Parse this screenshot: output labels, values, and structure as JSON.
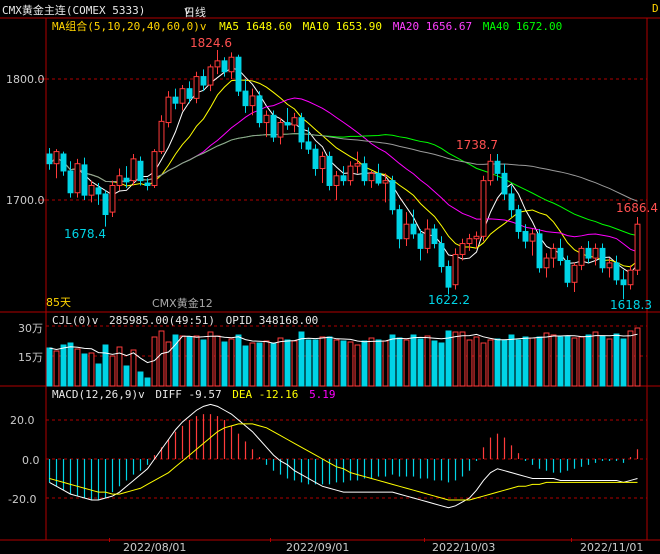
{
  "header": {
    "symbol": "CMX黄金主连(COMEX 5333)",
    "period": "日线",
    "period_arrow": "v",
    "right_mark": "D"
  },
  "main": {
    "ma_group": "MA组合(5,10,20,40,60,0)",
    "ma_arrow": "v",
    "ma5": "MA5 1648.60",
    "ma10": "MA10 1653.90",
    "ma20": "MA20 1656.67",
    "ma40": "MA40 1672.00",
    "annotations": {
      "high1": "1824.6",
      "high2": "1738.7",
      "last_high": "1686.4",
      "low1": "1678.4",
      "low2": "1622.2",
      "low3": "1618.3"
    },
    "days": "85天",
    "overlay_label": "CMX黄金12",
    "y_ticks": [
      "1800.0",
      "1700.0"
    ]
  },
  "volume": {
    "title": "CJL(0)",
    "arrow": "v",
    "value": "285985.00(49:51)",
    "opid": "OPID 348168.00",
    "y_ticks": [
      "30万",
      "15万"
    ]
  },
  "macd": {
    "title": "MACD(12,26,9)",
    "arrow": "v",
    "diff": "DIFF -9.57",
    "dea": "DEA -12.16",
    "macd_val": "5.19",
    "y_ticks": [
      "20.0",
      "0.0",
      "-20.0"
    ]
  },
  "x_axis": [
    "2022/08/01",
    "2022/09/01",
    "2022/10/03",
    "2022/11/01"
  ],
  "colors": {
    "up": "#ff3b3b",
    "down": "#00d4e6",
    "grid": "#b00000",
    "ma5": "#ffffff",
    "ma10": "#ffff00",
    "ma20": "#ff00ff",
    "ma40": "#00ff00",
    "ma60": "#9a9a9a"
  },
  "chart_data": {
    "type": "candlestick",
    "ylim": [
      1610,
      1860
    ],
    "candles": [
      {
        "o": 1738,
        "h": 1743,
        "l": 1725,
        "c": 1730
      },
      {
        "o": 1730,
        "h": 1742,
        "l": 1718,
        "c": 1740
      },
      {
        "o": 1738,
        "h": 1740,
        "l": 1720,
        "c": 1724
      },
      {
        "o": 1724,
        "h": 1732,
        "l": 1702,
        "c": 1706
      },
      {
        "o": 1706,
        "h": 1734,
        "l": 1702,
        "c": 1730
      },
      {
        "o": 1729,
        "h": 1735,
        "l": 1700,
        "c": 1704
      },
      {
        "o": 1704,
        "h": 1716,
        "l": 1698,
        "c": 1712
      },
      {
        "o": 1710,
        "h": 1714,
        "l": 1696,
        "c": 1705
      },
      {
        "o": 1705,
        "h": 1708,
        "l": 1678,
        "c": 1688
      },
      {
        "o": 1690,
        "h": 1716,
        "l": 1686,
        "c": 1712
      },
      {
        "o": 1712,
        "h": 1726,
        "l": 1708,
        "c": 1720
      },
      {
        "o": 1718,
        "h": 1728,
        "l": 1710,
        "c": 1715
      },
      {
        "o": 1716,
        "h": 1738,
        "l": 1712,
        "c": 1734
      },
      {
        "o": 1732,
        "h": 1736,
        "l": 1712,
        "c": 1716
      },
      {
        "o": 1714,
        "h": 1718,
        "l": 1708,
        "c": 1712
      },
      {
        "o": 1712,
        "h": 1742,
        "l": 1710,
        "c": 1740
      },
      {
        "o": 1740,
        "h": 1770,
        "l": 1738,
        "c": 1765
      },
      {
        "o": 1764,
        "h": 1790,
        "l": 1760,
        "c": 1785
      },
      {
        "o": 1785,
        "h": 1792,
        "l": 1775,
        "c": 1780
      },
      {
        "o": 1780,
        "h": 1795,
        "l": 1774,
        "c": 1792
      },
      {
        "o": 1792,
        "h": 1798,
        "l": 1780,
        "c": 1784
      },
      {
        "o": 1784,
        "h": 1806,
        "l": 1780,
        "c": 1802
      },
      {
        "o": 1802,
        "h": 1808,
        "l": 1790,
        "c": 1795
      },
      {
        "o": 1795,
        "h": 1812,
        "l": 1790,
        "c": 1810
      },
      {
        "o": 1810,
        "h": 1824,
        "l": 1804,
        "c": 1815
      },
      {
        "o": 1815,
        "h": 1818,
        "l": 1802,
        "c": 1806
      },
      {
        "o": 1806,
        "h": 1822,
        "l": 1800,
        "c": 1818
      },
      {
        "o": 1818,
        "h": 1820,
        "l": 1786,
        "c": 1790
      },
      {
        "o": 1790,
        "h": 1800,
        "l": 1772,
        "c": 1778
      },
      {
        "o": 1778,
        "h": 1792,
        "l": 1770,
        "c": 1786
      },
      {
        "o": 1786,
        "h": 1790,
        "l": 1760,
        "c": 1764
      },
      {
        "o": 1764,
        "h": 1774,
        "l": 1752,
        "c": 1770
      },
      {
        "o": 1770,
        "h": 1774,
        "l": 1748,
        "c": 1752
      },
      {
        "o": 1752,
        "h": 1768,
        "l": 1746,
        "c": 1764
      },
      {
        "o": 1764,
        "h": 1776,
        "l": 1758,
        "c": 1762
      },
      {
        "o": 1762,
        "h": 1772,
        "l": 1756,
        "c": 1768
      },
      {
        "o": 1768,
        "h": 1772,
        "l": 1742,
        "c": 1748
      },
      {
        "o": 1748,
        "h": 1760,
        "l": 1738,
        "c": 1742
      },
      {
        "o": 1742,
        "h": 1746,
        "l": 1720,
        "c": 1726
      },
      {
        "o": 1726,
        "h": 1740,
        "l": 1714,
        "c": 1736
      },
      {
        "o": 1736,
        "h": 1740,
        "l": 1708,
        "c": 1712
      },
      {
        "o": 1712,
        "h": 1724,
        "l": 1700,
        "c": 1720
      },
      {
        "o": 1720,
        "h": 1728,
        "l": 1712,
        "c": 1716
      },
      {
        "o": 1716,
        "h": 1732,
        "l": 1712,
        "c": 1728
      },
      {
        "o": 1728,
        "h": 1740,
        "l": 1722,
        "c": 1730
      },
      {
        "o": 1730,
        "h": 1736,
        "l": 1712,
        "c": 1716
      },
      {
        "o": 1716,
        "h": 1724,
        "l": 1710,
        "c": 1722
      },
      {
        "o": 1722,
        "h": 1730,
        "l": 1712,
        "c": 1714
      },
      {
        "o": 1714,
        "h": 1722,
        "l": 1698,
        "c": 1716
      },
      {
        "o": 1716,
        "h": 1720,
        "l": 1688,
        "c": 1692
      },
      {
        "o": 1692,
        "h": 1696,
        "l": 1660,
        "c": 1668
      },
      {
        "o": 1668,
        "h": 1690,
        "l": 1662,
        "c": 1680
      },
      {
        "o": 1680,
        "h": 1692,
        "l": 1668,
        "c": 1672
      },
      {
        "o": 1672,
        "h": 1676,
        "l": 1650,
        "c": 1660
      },
      {
        "o": 1660,
        "h": 1684,
        "l": 1656,
        "c": 1676
      },
      {
        "o": 1676,
        "h": 1680,
        "l": 1660,
        "c": 1664
      },
      {
        "o": 1664,
        "h": 1670,
        "l": 1640,
        "c": 1645
      },
      {
        "o": 1645,
        "h": 1650,
        "l": 1622,
        "c": 1628
      },
      {
        "o": 1630,
        "h": 1660,
        "l": 1626,
        "c": 1655
      },
      {
        "o": 1655,
        "h": 1668,
        "l": 1650,
        "c": 1664
      },
      {
        "o": 1664,
        "h": 1672,
        "l": 1658,
        "c": 1668
      },
      {
        "o": 1668,
        "h": 1674,
        "l": 1660,
        "c": 1670
      },
      {
        "o": 1670,
        "h": 1720,
        "l": 1666,
        "c": 1716
      },
      {
        "o": 1716,
        "h": 1738,
        "l": 1712,
        "c": 1732
      },
      {
        "o": 1732,
        "h": 1738,
        "l": 1716,
        "c": 1722
      },
      {
        "o": 1722,
        "h": 1730,
        "l": 1700,
        "c": 1705
      },
      {
        "o": 1705,
        "h": 1712,
        "l": 1686,
        "c": 1692
      },
      {
        "o": 1692,
        "h": 1696,
        "l": 1668,
        "c": 1674
      },
      {
        "o": 1674,
        "h": 1680,
        "l": 1660,
        "c": 1666
      },
      {
        "o": 1666,
        "h": 1676,
        "l": 1654,
        "c": 1672
      },
      {
        "o": 1672,
        "h": 1676,
        "l": 1640,
        "c": 1644
      },
      {
        "o": 1644,
        "h": 1656,
        "l": 1636,
        "c": 1652
      },
      {
        "o": 1652,
        "h": 1664,
        "l": 1644,
        "c": 1660
      },
      {
        "o": 1660,
        "h": 1668,
        "l": 1646,
        "c": 1650
      },
      {
        "o": 1650,
        "h": 1654,
        "l": 1628,
        "c": 1632
      },
      {
        "o": 1632,
        "h": 1648,
        "l": 1624,
        "c": 1646
      },
      {
        "o": 1646,
        "h": 1662,
        "l": 1642,
        "c": 1660
      },
      {
        "o": 1660,
        "h": 1666,
        "l": 1648,
        "c": 1652
      },
      {
        "o": 1652,
        "h": 1664,
        "l": 1646,
        "c": 1660
      },
      {
        "o": 1660,
        "h": 1664,
        "l": 1640,
        "c": 1644
      },
      {
        "o": 1644,
        "h": 1652,
        "l": 1636,
        "c": 1648
      },
      {
        "o": 1648,
        "h": 1654,
        "l": 1630,
        "c": 1634
      },
      {
        "o": 1634,
        "h": 1642,
        "l": 1618,
        "c": 1630
      },
      {
        "o": 1630,
        "h": 1646,
        "l": 1626,
        "c": 1642
      },
      {
        "o": 1642,
        "h": 1686,
        "l": 1638,
        "c": 1680
      }
    ],
    "volume": [
      190,
      175,
      205,
      215,
      185,
      160,
      165,
      110,
      205,
      150,
      195,
      100,
      180,
      70,
      40,
      245,
      275,
      220,
      255,
      250,
      245,
      250,
      230,
      270,
      250,
      220,
      235,
      255,
      200,
      215,
      215,
      225,
      215,
      240,
      230,
      225,
      270,
      230,
      230,
      245,
      245,
      230,
      225,
      220,
      205,
      225,
      240,
      230,
      225,
      255,
      240,
      230,
      255,
      235,
      250,
      225,
      215,
      275,
      270,
      270,
      230,
      245,
      215,
      230,
      235,
      230,
      255,
      230,
      245,
      240,
      245,
      265,
      255,
      245,
      250,
      240,
      245,
      255,
      270,
      250,
      235,
      260,
      235,
      275,
      290
    ],
    "macd_hist": [
      -12,
      -14,
      -16,
      -18,
      -19,
      -20,
      -21,
      -21,
      -20,
      -17,
      -14,
      -11,
      -8,
      -6,
      -3,
      2,
      6,
      10,
      14,
      17,
      20,
      22,
      23,
      23,
      22,
      20,
      17,
      13,
      9,
      5,
      1,
      -3,
      -6,
      -8,
      -10,
      -11,
      -12,
      -13,
      -13,
      -13,
      -13,
      -12,
      -12,
      -11,
      -11,
      -10,
      -10,
      -9,
      -9,
      -8,
      -9,
      -9,
      -9,
      -10,
      -10,
      -11,
      -11,
      -12,
      -11,
      -9,
      -6,
      -1,
      6,
      11,
      13,
      11,
      7,
      3,
      -1,
      -3,
      -5,
      -6,
      -7,
      -7,
      -6,
      -5,
      -4,
      -3,
      -2,
      -1,
      -1,
      -1,
      -2,
      1,
      5
    ],
    "macd_diff": [
      -12,
      -14,
      -16,
      -18,
      -19,
      -20,
      -21,
      -21,
      -20,
      -19,
      -17,
      -14,
      -11,
      -8,
      -5,
      0,
      5,
      10,
      15,
      19,
      22,
      25,
      27,
      28,
      27,
      25,
      23,
      20,
      17,
      14,
      10,
      6,
      2,
      -1,
      -3,
      -6,
      -8,
      -10,
      -12,
      -14,
      -15,
      -16,
      -17,
      -17,
      -17,
      -17,
      -17,
      -17,
      -17,
      -17,
      -18,
      -19,
      -20,
      -21,
      -22,
      -23,
      -24,
      -25,
      -24,
      -22,
      -20,
      -16,
      -11,
      -7,
      -5,
      -6,
      -7,
      -8,
      -9,
      -10,
      -10,
      -10,
      -10,
      -11,
      -11,
      -11,
      -11,
      -11,
      -11,
      -11,
      -11,
      -11,
      -12,
      -11,
      -10
    ],
    "macd_dea": [
      -10,
      -11,
      -12,
      -13,
      -14,
      -15,
      -16,
      -17,
      -17,
      -18,
      -18,
      -17,
      -16,
      -15,
      -13,
      -11,
      -9,
      -7,
      -4,
      -1,
      2,
      5,
      8,
      11,
      14,
      16,
      17,
      18,
      18,
      18,
      17,
      16,
      14,
      12,
      10,
      8,
      6,
      4,
      2,
      0,
      -2,
      -4,
      -5,
      -7,
      -8,
      -9,
      -10,
      -11,
      -12,
      -13,
      -14,
      -15,
      -16,
      -17,
      -18,
      -19,
      -20,
      -21,
      -21,
      -21,
      -21,
      -20,
      -19,
      -18,
      -17,
      -16,
      -15,
      -14,
      -14,
      -13,
      -13,
      -12,
      -12,
      -12,
      -12,
      -12,
      -12,
      -12,
      -12,
      -12,
      -12,
      -12,
      -12,
      -12,
      -12
    ]
  }
}
